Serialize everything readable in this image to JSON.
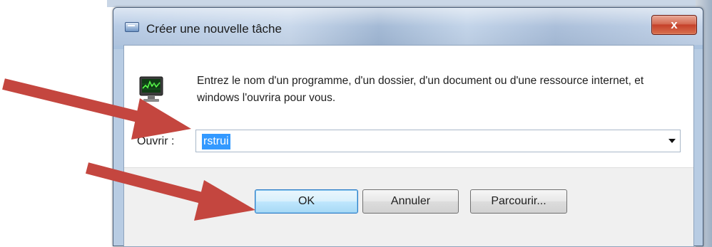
{
  "window": {
    "title": "Créer une nouvelle tâche",
    "close_label": "x"
  },
  "dialog": {
    "description": "Entrez le nom d'un programme, d'un dossier, d'un document ou d'une ressource internet, et windows l'ouvrira pour vous.",
    "open_label": "Ouvrir :",
    "open_value": "rstrui"
  },
  "buttons": {
    "ok": "OK",
    "cancel": "Annuler",
    "browse": "Parcourir..."
  },
  "icons": [
    "app-monitor-icon",
    "window-title-icon",
    "dropdown-arrow-icon",
    "annotation-arrow"
  ],
  "colors": {
    "annotation_arrow": "#c4463f",
    "selection": "#3399ff",
    "close_button": "#c5402a"
  }
}
